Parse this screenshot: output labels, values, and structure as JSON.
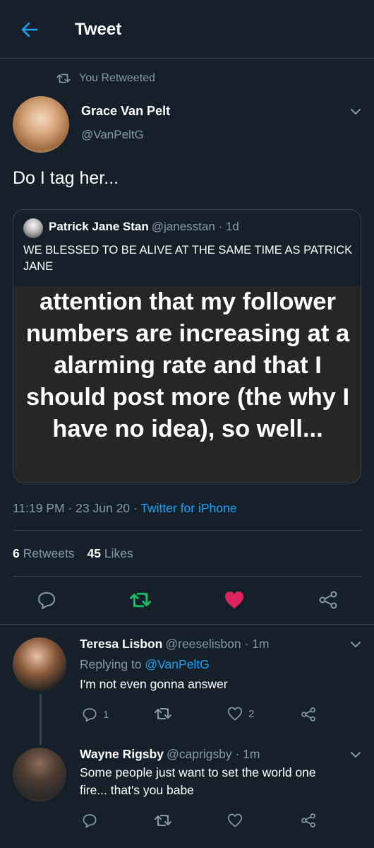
{
  "header": {
    "title": "Tweet",
    "back_icon": "arrow-left-icon"
  },
  "context": {
    "label": "You Retweeted",
    "icon": "retweet-icon"
  },
  "author": {
    "name": "Grace Van Pelt",
    "handle": "@VanPeltG"
  },
  "tweet": {
    "text": "Do I tag her..."
  },
  "quote": {
    "name": "Patrick Jane Stan",
    "meta": "@janesstan · 1d",
    "text": "WE BLESSED TO BE ALIVE AT THE SAME TIME AS PATRICK JANE",
    "media_text": "attention that my follower numbers are increasing at a alarming rate and that I should post more (the why I have no idea), so well..."
  },
  "timestamp": {
    "time": "11:19 PM · 23 Jun 20 · ",
    "source": "Twitter for iPhone"
  },
  "stats": {
    "retweets_count": "6",
    "retweets_label": "Retweets",
    "likes_count": "45",
    "likes_label": "Likes"
  },
  "actions": [
    {
      "name": "reply",
      "icon": "reply-icon"
    },
    {
      "name": "retweet",
      "icon": "retweet-icon",
      "active": true
    },
    {
      "name": "like",
      "icon": "heart-icon",
      "active": true
    },
    {
      "name": "share",
      "icon": "share-icon"
    }
  ],
  "replies": [
    {
      "name": "Teresa Lisbon",
      "meta": "@reeselisbon · 1m",
      "replying_prefix": "Replying to ",
      "replying_handle": "@VanPeltG",
      "text": "I'm not even gonna answer",
      "reply_count": "1",
      "like_count": "2"
    },
    {
      "name": "Wayne Rigsby",
      "meta": "@caprigsby · 1m",
      "text_line1": "Some people just want to set the world one",
      "text_line2": "fire... that's you babe"
    }
  ],
  "colors": {
    "background": "#15202b",
    "accent": "#1da1f2",
    "retweet": "#17bf63",
    "like": "#e0245e",
    "muted": "#8899a6",
    "border": "#38444d"
  }
}
